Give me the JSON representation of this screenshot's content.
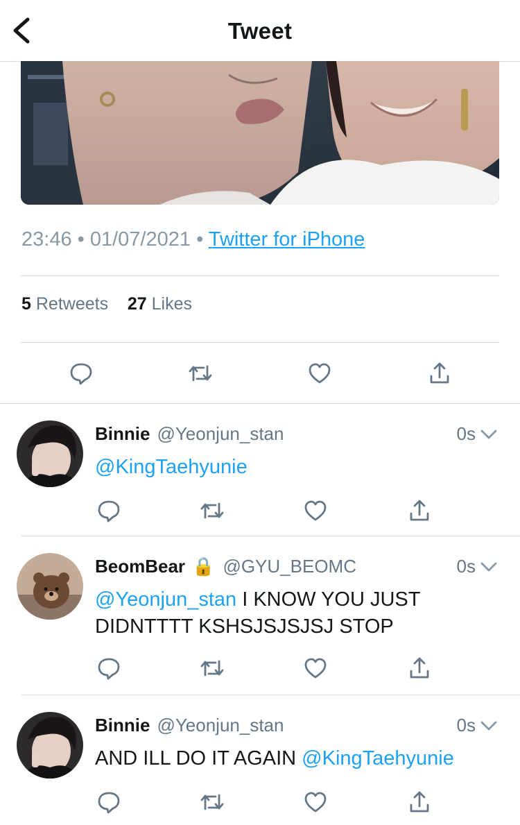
{
  "header": {
    "title": "Tweet",
    "back_icon": "chevron-left-icon"
  },
  "tweet": {
    "time": "23:46",
    "date": "01/07/2021",
    "source": "Twitter for iPhone",
    "retweets_count": "5",
    "retweets_label": "Retweets",
    "likes_count": "27",
    "likes_label": "Likes"
  },
  "colors": {
    "link": "#1da1f2",
    "muted": "#657786",
    "text": "#14171a",
    "divider": "#d7dce0"
  },
  "replies": [
    {
      "name": "Binnie",
      "handle": "@Yeonjun_stan",
      "time": "0s",
      "mention_before": "@KingTaehyunie",
      "text": "",
      "mention_after": ""
    },
    {
      "name": "BeomBear",
      "lock": "🔒",
      "handle": "@GYU_BEOMC",
      "time": "0s",
      "mention_before": "@Yeonjun_stan",
      "text": " I KNOW YOU JUST DIDNTTTT KSHSJSJSJSJ STOP",
      "mention_after": ""
    },
    {
      "name": "Binnie",
      "handle": "@Yeonjun_stan",
      "time": "0s",
      "mention_before": "",
      "text": "AND ILL DO IT AGAIN ",
      "mention_after": "@KingTaehyunie"
    }
  ]
}
